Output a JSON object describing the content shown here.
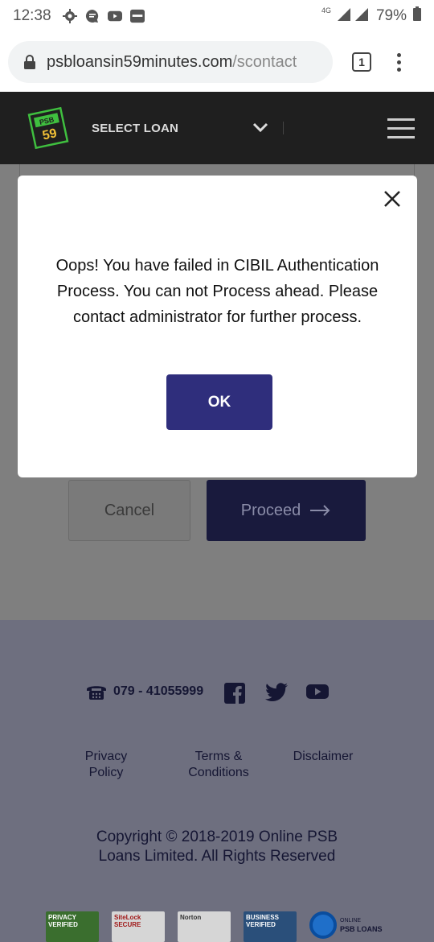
{
  "status_bar": {
    "time": "12:38",
    "network": "4G",
    "battery": "79%"
  },
  "browser": {
    "url_domain": "psbloansin59minutes.com",
    "url_path": "/scontact",
    "tab_count": "1"
  },
  "header": {
    "logo_top": "PSB",
    "logo_number": "59",
    "select_loan_label": "SELECT LOAN"
  },
  "form": {
    "cancel_label": "Cancel",
    "proceed_label": "Proceed"
  },
  "modal": {
    "message": "Oops! You have failed in CIBIL Authentication Process. You can not Process ahead. Please contact administrator for further process.",
    "ok_label": "OK"
  },
  "footer": {
    "phone": "079 - 41055999",
    "links": {
      "privacy": "Privacy Policy",
      "terms": "Terms & Conditions",
      "disclaimer": "Disclaimer"
    },
    "copyright": "Copyright © 2018-2019 Online PSB Loans Limited. All Rights Reserved",
    "badges": {
      "privacy": "PRIVACY VERIFIED",
      "sitelock": "SiteLock SECURE",
      "norton": "Norton",
      "business": "BUSINESS VERIFIED",
      "online_label": "ONLINE",
      "psb_loans_label": "PSB LOANS"
    }
  },
  "colors": {
    "primary": "#2f2e7c",
    "header_bg": "#1f1f1f",
    "logo_green": "#3fbf3f",
    "logo_yellow": "#f2c037"
  }
}
